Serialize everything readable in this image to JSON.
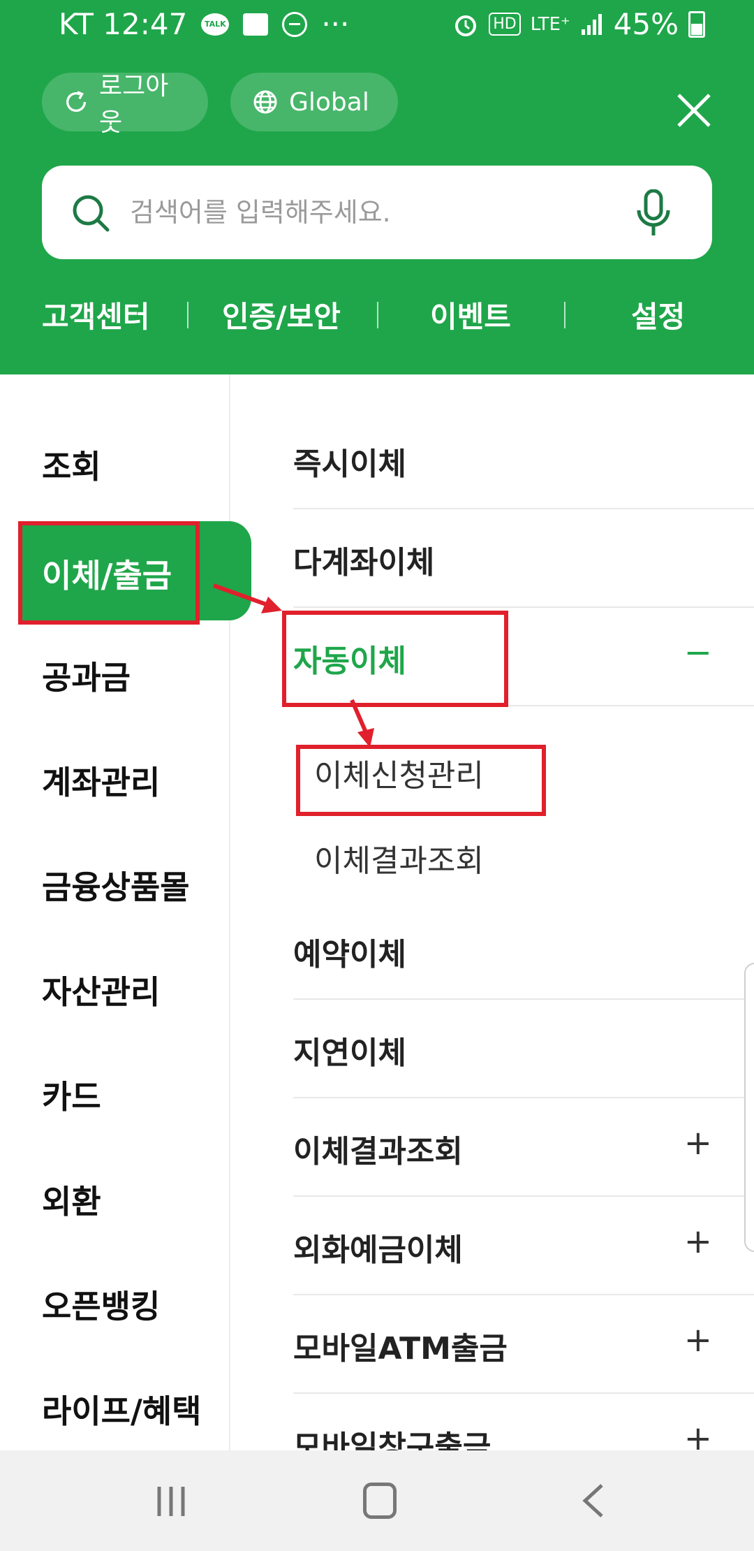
{
  "status_bar": {
    "carrier_time": "KT 12:47",
    "talk_icon_text": "TALK",
    "more": "···",
    "hd": "HD",
    "lte": "LTE⁺",
    "battery": "45%"
  },
  "header": {
    "logout_label": "로그아웃",
    "global_label": "Global",
    "search_placeholder": "검색어를 입력해주세요.",
    "quick_nav": [
      "고객센터",
      "인증/보안",
      "이벤트",
      "설정"
    ]
  },
  "left_nav": {
    "items": [
      "조회",
      "이체/출금",
      "공과금",
      "계좌관리",
      "금융상품몰",
      "자산관리",
      "카드",
      "외환",
      "오픈뱅킹",
      "라이프/혜택"
    ],
    "active": "이체/출금"
  },
  "right_menu": {
    "items": [
      {
        "label": "즉시이체",
        "sign": ""
      },
      {
        "label": "다계좌이체",
        "sign": ""
      },
      {
        "label": "자동이체",
        "sign": "−"
      },
      {
        "label": "예약이체",
        "sign": ""
      },
      {
        "label": "지연이체",
        "sign": ""
      },
      {
        "label": "이체결과조회",
        "sign": "+"
      },
      {
        "label": "외화예금이체",
        "sign": "+"
      },
      {
        "label": "모바일ATM출금",
        "sign": "+"
      },
      {
        "label": "모바일창구출금",
        "sign": "+"
      }
    ],
    "sub_items": [
      "이체신청관리",
      "이체결과조회"
    ]
  },
  "colors": {
    "brand_green": "#1fa64a",
    "annotation_red": "#e0202c"
  },
  "icons": [
    "refresh-icon",
    "globe-icon",
    "close-icon",
    "search-icon",
    "mic-icon",
    "recent-apps-icon",
    "home-icon",
    "back-icon"
  ]
}
